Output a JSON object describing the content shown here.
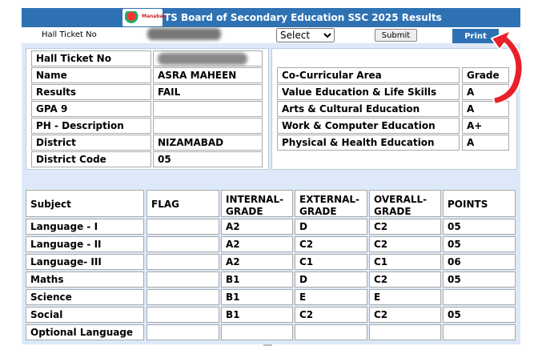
{
  "header": {
    "title": "TS Board of Secondary Education SSC 2025 Results",
    "logo_text": "Manabadi"
  },
  "form": {
    "hall_ticket_label": "Hall Ticket No",
    "select_value": "Select",
    "submit_label": "Submit",
    "print_label": "Print"
  },
  "student": {
    "hall_ticket_label": "Hall Ticket No",
    "name_label": "Name",
    "name_value": "ASRA MAHEEN",
    "results_label": "Results",
    "results_value": "FAIL",
    "gpa_label": "GPA 9",
    "gpa_value": "",
    "ph_label": "PH - Description",
    "ph_value": "",
    "district_label": "District",
    "district_value": "NIZAMABAD",
    "district_code_label": "District Code",
    "district_code_value": "05"
  },
  "co_curricular": {
    "area_header": "Co-Curricular Area",
    "grade_header": "Grade",
    "rows": [
      {
        "area": "Value Education & Life Skills",
        "grade": "A"
      },
      {
        "area": "Arts & Cultural Education",
        "grade": "A"
      },
      {
        "area": "Work & Computer Education",
        "grade": "A+"
      },
      {
        "area": "Physical & Health Education",
        "grade": "A"
      }
    ]
  },
  "marks": {
    "headers": [
      "Subject",
      "FLAG",
      "INTERNAL-GRADE",
      "EXTERNAL-GRADE",
      "OVERALL-GRADE",
      "POINTS"
    ],
    "rows": [
      {
        "subject": "Language - I",
        "flag": "",
        "internal": "A2",
        "external": "D",
        "overall": "C2",
        "points": "05"
      },
      {
        "subject": "Language - II",
        "flag": "",
        "internal": "A2",
        "external": "C2",
        "overall": "C2",
        "points": "05"
      },
      {
        "subject": "Language- III",
        "flag": "",
        "internal": "A2",
        "external": "C1",
        "overall": "C1",
        "points": "06"
      },
      {
        "subject": "Maths",
        "flag": "",
        "internal": "B1",
        "external": "D",
        "overall": "C2",
        "points": "05"
      },
      {
        "subject": "Science",
        "flag": "",
        "internal": "B1",
        "external": "E",
        "overall": "E",
        "points": ""
      },
      {
        "subject": "Social",
        "flag": "",
        "internal": "B1",
        "external": "C2",
        "overall": "C2",
        "points": "05"
      },
      {
        "subject": "Optional Language",
        "flag": "",
        "internal": "",
        "external": "",
        "overall": "",
        "points": ""
      }
    ]
  },
  "colors": {
    "header_bg": "#2e72b4",
    "panel_bg": "#dde9f8",
    "arrow": "#e8202a"
  }
}
